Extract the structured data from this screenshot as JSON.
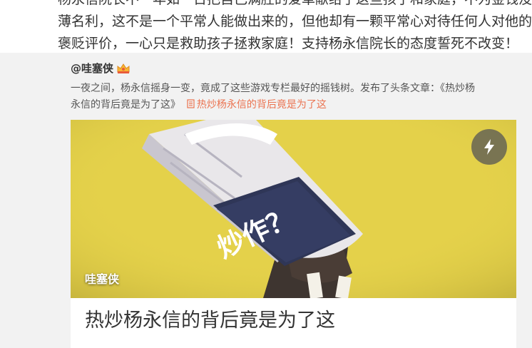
{
  "top_post": {
    "lines": [
      "杨永信院长不一年如一日把自己满腔的爱革献给了这些孩子和家庭，不为金钱没",
      "薄名利，这不是一个平常人能做出来的，但他却有一颗平常心对待任何人对他的",
      "褒贬评价，一心只是救助孩子拯救家庭！支持杨永信院长的态度誓死不改变！"
    ]
  },
  "repost": {
    "author": "@哇塞侠",
    "badge_icon": "vip-crown-icon",
    "text_line1": "一夜之间，杨永信摇身一变，竟成了这些游戏专栏最好的摇钱树。发布了头条文章：《热炒杨",
    "text_line2_prefix": "永信的背后竟是为了这》",
    "article_link": "热炒杨永信的背后竟是为了这"
  },
  "card": {
    "cover_text": "炒作？",
    "cover_author": "哇塞侠",
    "flash_icon": "lightning-icon",
    "title": "热炒杨永信的背后竟是为了这"
  },
  "colors": {
    "link": "#eb7350",
    "page_bg": "#f2f2f2",
    "cover_bg": "#e4d14a"
  }
}
